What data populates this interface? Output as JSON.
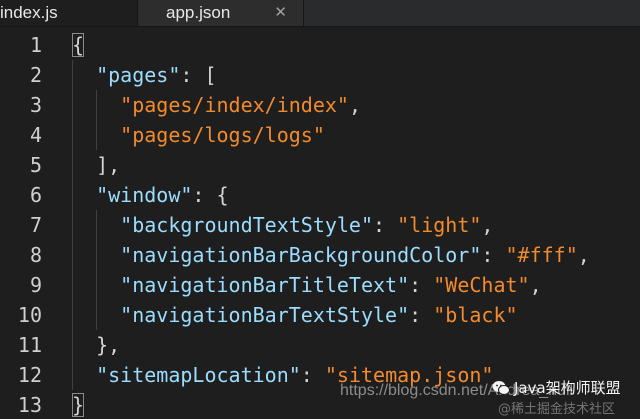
{
  "tabs": [
    {
      "label": "index.js"
    },
    {
      "label": "app.json",
      "close_glyph": "✕"
    }
  ],
  "code_lines": [
    {
      "n": "1",
      "indent": 0,
      "tokens": [
        {
          "t": "{",
          "c": "pun",
          "hl": true
        }
      ]
    },
    {
      "n": "2",
      "indent": 1,
      "tokens": [
        {
          "t": "\"pages\"",
          "c": "key"
        },
        {
          "t": ": [",
          "c": "pun"
        }
      ]
    },
    {
      "n": "3",
      "indent": 2,
      "tokens": [
        {
          "t": "\"pages/index/index\"",
          "c": "str"
        },
        {
          "t": ",",
          "c": "pun"
        }
      ]
    },
    {
      "n": "4",
      "indent": 2,
      "tokens": [
        {
          "t": "\"pages/logs/logs\"",
          "c": "str"
        }
      ]
    },
    {
      "n": "5",
      "indent": 1,
      "tokens": [
        {
          "t": "],",
          "c": "pun"
        }
      ]
    },
    {
      "n": "6",
      "indent": 1,
      "tokens": [
        {
          "t": "\"window\"",
          "c": "key"
        },
        {
          "t": ": {",
          "c": "pun"
        }
      ]
    },
    {
      "n": "7",
      "indent": 2,
      "tokens": [
        {
          "t": "\"backgroundTextStyle\"",
          "c": "key"
        },
        {
          "t": ": ",
          "c": "pun"
        },
        {
          "t": "\"light\"",
          "c": "str"
        },
        {
          "t": ",",
          "c": "pun"
        }
      ]
    },
    {
      "n": "8",
      "indent": 2,
      "tokens": [
        {
          "t": "\"navigationBarBackgroundColor\"",
          "c": "key"
        },
        {
          "t": ": ",
          "c": "pun"
        },
        {
          "t": "\"#fff\"",
          "c": "str"
        },
        {
          "t": ",",
          "c": "pun"
        }
      ]
    },
    {
      "n": "9",
      "indent": 2,
      "tokens": [
        {
          "t": "\"navigationBarTitleText\"",
          "c": "key"
        },
        {
          "t": ": ",
          "c": "pun"
        },
        {
          "t": "\"WeChat\"",
          "c": "str"
        },
        {
          "t": ",",
          "c": "pun"
        }
      ]
    },
    {
      "n": "10",
      "indent": 2,
      "tokens": [
        {
          "t": "\"navigationBarTextStyle\"",
          "c": "key"
        },
        {
          "t": ": ",
          "c": "pun"
        },
        {
          "t": "\"black\"",
          "c": "str"
        }
      ]
    },
    {
      "n": "11",
      "indent": 1,
      "tokens": [
        {
          "t": "},",
          "c": "pun"
        }
      ]
    },
    {
      "n": "12",
      "indent": 1,
      "tokens": [
        {
          "t": "\"sitemapLocation\"",
          "c": "key"
        },
        {
          "t": ": ",
          "c": "pun"
        },
        {
          "t": "\"sitemap.json\"",
          "c": "str"
        }
      ]
    },
    {
      "n": "13",
      "indent": 0,
      "tokens": [
        {
          "t": "}",
          "c": "pun",
          "hl": true
        }
      ]
    }
  ],
  "watermark": {
    "url": "https://blog.csdn.net/Andrea_null",
    "brand": "Java架构师联盟",
    "sub": "@稀土掘金技术社区"
  },
  "colors": {
    "background": "#1e1e1e",
    "tabbar": "#2a2b2d",
    "string": "#f28a2e",
    "key": "#9cdcfe",
    "punctuation": "#d4d4d4",
    "line_number": "#d0d0d0"
  }
}
